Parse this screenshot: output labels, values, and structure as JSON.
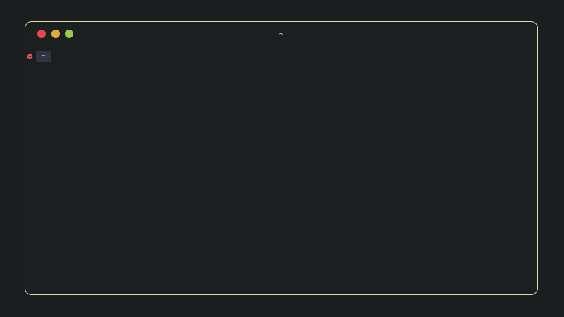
{
  "window": {
    "title": "~",
    "controls": {
      "close_color": "#e5484d",
      "minimize_color": "#e2ae3b",
      "maximize_color": "#9cc94b"
    },
    "border_color": "#e3dba6"
  },
  "terminal": {
    "prompt": {
      "icon": "ghost-icon",
      "icon_color": "#e5535d",
      "cwd": "~",
      "cwd_background": "#2f3540"
    }
  }
}
